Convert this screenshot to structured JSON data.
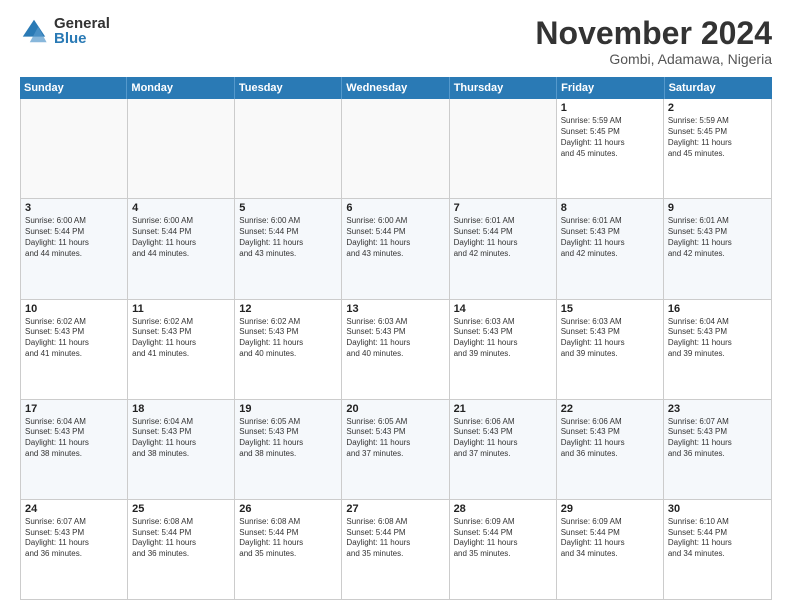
{
  "logo": {
    "general": "General",
    "blue": "Blue"
  },
  "title": "November 2024",
  "location": "Gombi, Adamawa, Nigeria",
  "days_of_week": [
    "Sunday",
    "Monday",
    "Tuesday",
    "Wednesday",
    "Thursday",
    "Friday",
    "Saturday"
  ],
  "weeks": [
    [
      {
        "day": "",
        "info": "",
        "empty": true
      },
      {
        "day": "",
        "info": "",
        "empty": true
      },
      {
        "day": "",
        "info": "",
        "empty": true
      },
      {
        "day": "",
        "info": "",
        "empty": true
      },
      {
        "day": "",
        "info": "",
        "empty": true
      },
      {
        "day": "1",
        "info": "Sunrise: 5:59 AM\nSunset: 5:45 PM\nDaylight: 11 hours\nand 45 minutes.",
        "empty": false
      },
      {
        "day": "2",
        "info": "Sunrise: 5:59 AM\nSunset: 5:45 PM\nDaylight: 11 hours\nand 45 minutes.",
        "empty": false
      }
    ],
    [
      {
        "day": "3",
        "info": "Sunrise: 6:00 AM\nSunset: 5:44 PM\nDaylight: 11 hours\nand 44 minutes.",
        "empty": false
      },
      {
        "day": "4",
        "info": "Sunrise: 6:00 AM\nSunset: 5:44 PM\nDaylight: 11 hours\nand 44 minutes.",
        "empty": false
      },
      {
        "day": "5",
        "info": "Sunrise: 6:00 AM\nSunset: 5:44 PM\nDaylight: 11 hours\nand 43 minutes.",
        "empty": false
      },
      {
        "day": "6",
        "info": "Sunrise: 6:00 AM\nSunset: 5:44 PM\nDaylight: 11 hours\nand 43 minutes.",
        "empty": false
      },
      {
        "day": "7",
        "info": "Sunrise: 6:01 AM\nSunset: 5:44 PM\nDaylight: 11 hours\nand 42 minutes.",
        "empty": false
      },
      {
        "day": "8",
        "info": "Sunrise: 6:01 AM\nSunset: 5:43 PM\nDaylight: 11 hours\nand 42 minutes.",
        "empty": false
      },
      {
        "day": "9",
        "info": "Sunrise: 6:01 AM\nSunset: 5:43 PM\nDaylight: 11 hours\nand 42 minutes.",
        "empty": false
      }
    ],
    [
      {
        "day": "10",
        "info": "Sunrise: 6:02 AM\nSunset: 5:43 PM\nDaylight: 11 hours\nand 41 minutes.",
        "empty": false
      },
      {
        "day": "11",
        "info": "Sunrise: 6:02 AM\nSunset: 5:43 PM\nDaylight: 11 hours\nand 41 minutes.",
        "empty": false
      },
      {
        "day": "12",
        "info": "Sunrise: 6:02 AM\nSunset: 5:43 PM\nDaylight: 11 hours\nand 40 minutes.",
        "empty": false
      },
      {
        "day": "13",
        "info": "Sunrise: 6:03 AM\nSunset: 5:43 PM\nDaylight: 11 hours\nand 40 minutes.",
        "empty": false
      },
      {
        "day": "14",
        "info": "Sunrise: 6:03 AM\nSunset: 5:43 PM\nDaylight: 11 hours\nand 39 minutes.",
        "empty": false
      },
      {
        "day": "15",
        "info": "Sunrise: 6:03 AM\nSunset: 5:43 PM\nDaylight: 11 hours\nand 39 minutes.",
        "empty": false
      },
      {
        "day": "16",
        "info": "Sunrise: 6:04 AM\nSunset: 5:43 PM\nDaylight: 11 hours\nand 39 minutes.",
        "empty": false
      }
    ],
    [
      {
        "day": "17",
        "info": "Sunrise: 6:04 AM\nSunset: 5:43 PM\nDaylight: 11 hours\nand 38 minutes.",
        "empty": false
      },
      {
        "day": "18",
        "info": "Sunrise: 6:04 AM\nSunset: 5:43 PM\nDaylight: 11 hours\nand 38 minutes.",
        "empty": false
      },
      {
        "day": "19",
        "info": "Sunrise: 6:05 AM\nSunset: 5:43 PM\nDaylight: 11 hours\nand 38 minutes.",
        "empty": false
      },
      {
        "day": "20",
        "info": "Sunrise: 6:05 AM\nSunset: 5:43 PM\nDaylight: 11 hours\nand 37 minutes.",
        "empty": false
      },
      {
        "day": "21",
        "info": "Sunrise: 6:06 AM\nSunset: 5:43 PM\nDaylight: 11 hours\nand 37 minutes.",
        "empty": false
      },
      {
        "day": "22",
        "info": "Sunrise: 6:06 AM\nSunset: 5:43 PM\nDaylight: 11 hours\nand 36 minutes.",
        "empty": false
      },
      {
        "day": "23",
        "info": "Sunrise: 6:07 AM\nSunset: 5:43 PM\nDaylight: 11 hours\nand 36 minutes.",
        "empty": false
      }
    ],
    [
      {
        "day": "24",
        "info": "Sunrise: 6:07 AM\nSunset: 5:43 PM\nDaylight: 11 hours\nand 36 minutes.",
        "empty": false
      },
      {
        "day": "25",
        "info": "Sunrise: 6:08 AM\nSunset: 5:44 PM\nDaylight: 11 hours\nand 36 minutes.",
        "empty": false
      },
      {
        "day": "26",
        "info": "Sunrise: 6:08 AM\nSunset: 5:44 PM\nDaylight: 11 hours\nand 35 minutes.",
        "empty": false
      },
      {
        "day": "27",
        "info": "Sunrise: 6:08 AM\nSunset: 5:44 PM\nDaylight: 11 hours\nand 35 minutes.",
        "empty": false
      },
      {
        "day": "28",
        "info": "Sunrise: 6:09 AM\nSunset: 5:44 PM\nDaylight: 11 hours\nand 35 minutes.",
        "empty": false
      },
      {
        "day": "29",
        "info": "Sunrise: 6:09 AM\nSunset: 5:44 PM\nDaylight: 11 hours\nand 34 minutes.",
        "empty": false
      },
      {
        "day": "30",
        "info": "Sunrise: 6:10 AM\nSunset: 5:44 PM\nDaylight: 11 hours\nand 34 minutes.",
        "empty": false
      }
    ]
  ]
}
